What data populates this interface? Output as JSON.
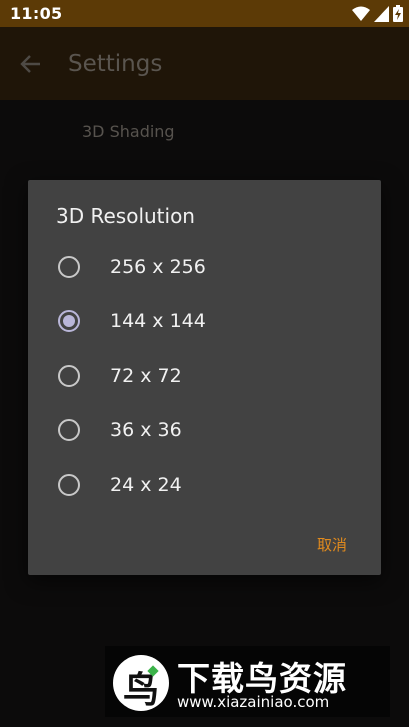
{
  "status_bar": {
    "time": "11:05",
    "icons": [
      "wifi-icon",
      "signal-icon",
      "battery-icon"
    ]
  },
  "app_bar": {
    "back_icon": "arrow-left-icon",
    "title": "Settings"
  },
  "background": {
    "preference_title": "3D Shading"
  },
  "dialog": {
    "title": "3D Resolution",
    "options": [
      {
        "label": "256 x 256",
        "selected": false
      },
      {
        "label": "144 x 144",
        "selected": true
      },
      {
        "label": "72 x 72",
        "selected": false
      },
      {
        "label": "36 x 36",
        "selected": false
      },
      {
        "label": "24 x 24",
        "selected": false
      }
    ],
    "cancel_label": "取消"
  },
  "watermark": {
    "title": "下载鸟资源",
    "url": "www.xiazainiao.com"
  },
  "colors": {
    "status_bar_bg": "#5c3a06",
    "accent": "#e08a1e",
    "radio_selected": "#b9b6d8",
    "dialog_bg": "#424242"
  }
}
